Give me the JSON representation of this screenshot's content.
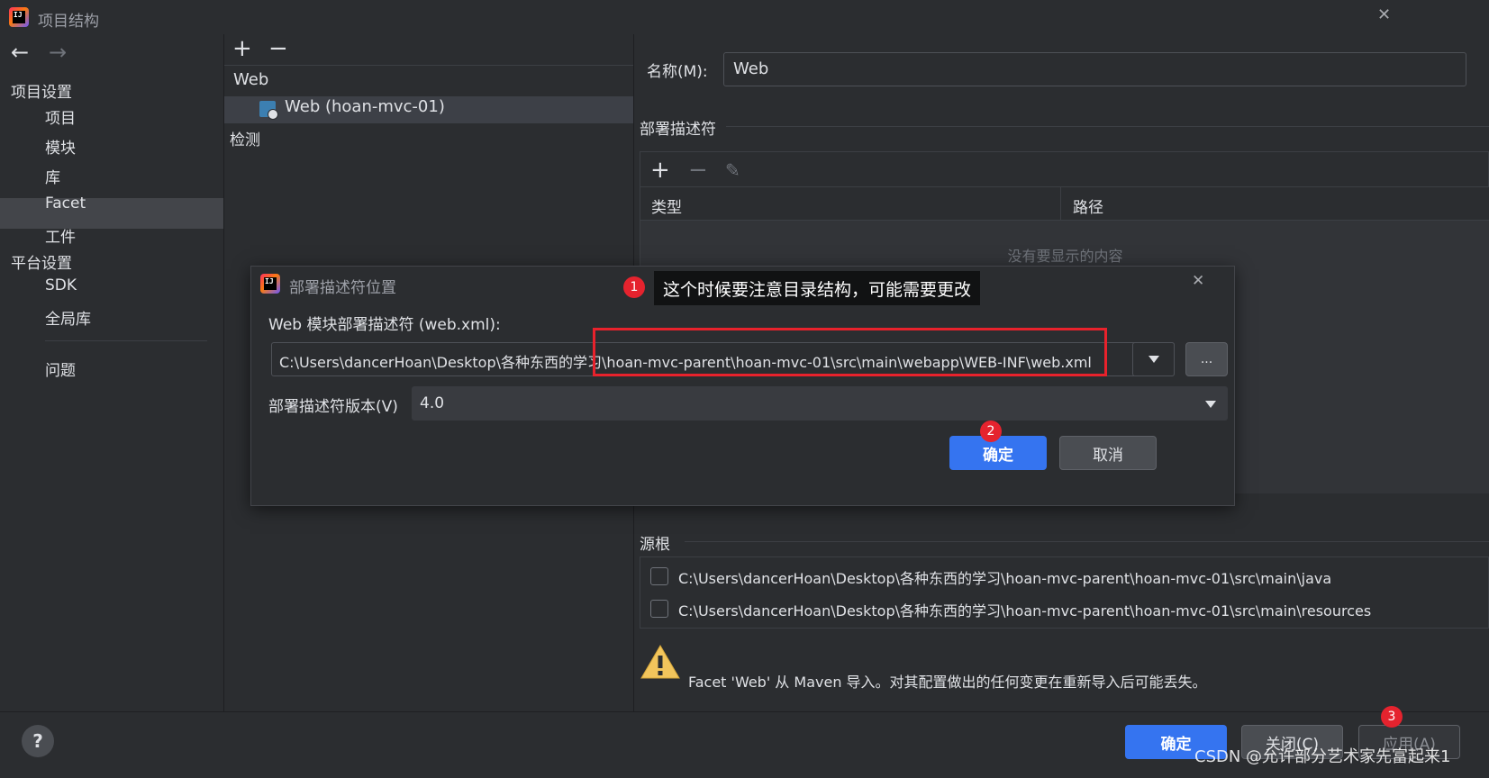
{
  "window": {
    "title": "项目结构",
    "close_glyph": "✕"
  },
  "left_nav": {
    "back_glyph": "←",
    "forward_glyph": "→",
    "project_settings_heading": "项目设置",
    "project_items": [
      "项目",
      "模块",
      "库",
      "Facet",
      "工件"
    ],
    "selected_item": "Facet",
    "platform_settings_heading": "平台设置",
    "platform_items": [
      "SDK",
      "全局库"
    ],
    "problems_label": "问题"
  },
  "middle": {
    "add_glyph": "+",
    "remove_glyph": "−",
    "group_label": "Web",
    "facet_item_label": "Web (hoan-mvc-01)",
    "detection_label": "检测"
  },
  "right": {
    "name_label": "名称(M):",
    "name_value": "Web",
    "deploy_descriptor_heading": "部署描述符",
    "table_columns": [
      "类型",
      "路径"
    ],
    "empty_text": "没有要显示的内容",
    "source_roots_heading": "源根",
    "source_roots": [
      "C:\\Users\\dancerHoan\\Desktop\\各种东西的学习\\hoan-mvc-parent\\hoan-mvc-01\\src\\main\\java",
      "C:\\Users\\dancerHoan\\Desktop\\各种东西的学习\\hoan-mvc-parent\\hoan-mvc-01\\src\\main\\resources"
    ],
    "warning_text": "Facet 'Web' 从 Maven 导入。对其配置做出的任何变更在重新导入后可能丢失。"
  },
  "dialog": {
    "title": "部署描述符位置",
    "descriptor_label": "Web 模块部署描述符 (web.xml):",
    "path_value": "C:\\Users\\dancerHoan\\Desktop\\各种东西的学习\\hoan-mvc-parent\\hoan-mvc-01\\src\\main\\webapp\\WEB-INF\\web.xml",
    "browse_label": "...",
    "version_label": "部署描述符版本(V)",
    "version_value": "4.0",
    "ok_label": "确定",
    "cancel_label": "取消",
    "close_glyph": "✕"
  },
  "annotations": {
    "note_text": "这个时候要注意目录结构，可能需要更改",
    "badge1": "1",
    "badge2": "2",
    "badge3": "3"
  },
  "bottom": {
    "help_glyph": "?",
    "ok_label": "确定",
    "close_label": "关闭(C)",
    "apply_label": "应用(A)",
    "watermark": "CSDN @允许部分艺术家先富起来1"
  },
  "colors": {
    "background": "#2b2d30",
    "accent": "#3574f0",
    "annotation_red": "#e8222c",
    "warning_yellow": "#f2c55c"
  }
}
